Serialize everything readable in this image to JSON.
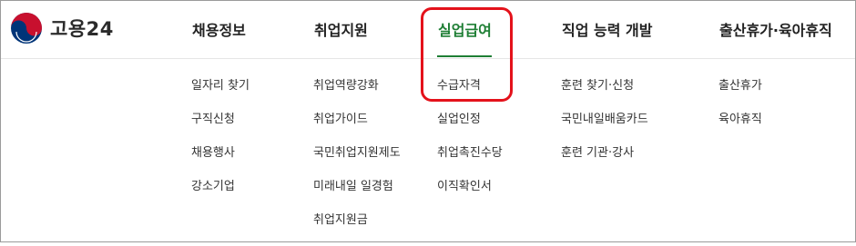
{
  "logo": {
    "text": "고용24",
    "icon": "government-taeguk-emblem-icon"
  },
  "nav": [
    {
      "label": "채용정보"
    },
    {
      "label": "취업지원"
    },
    {
      "label": "실업급여",
      "active": true
    },
    {
      "label": "직업 능력 개발"
    },
    {
      "label": "출산휴가·육아휴직"
    }
  ],
  "submenus": [
    [
      "일자리 찾기",
      "구직신청",
      "채용행사",
      "강소기업"
    ],
    [
      "취업역량강화",
      "취업가이드",
      "국민취업지원제도",
      "미래내일 일경험",
      "취업지원금"
    ],
    [
      "수급자격",
      "실업인정",
      "취업촉진수당",
      "이직확인서"
    ],
    [
      "훈련 찾기·신청",
      "국민내일배움카드",
      "훈련 기관·강사"
    ],
    [
      "출산휴가",
      "육아휴직"
    ]
  ],
  "colors": {
    "accent": "#1e7e34",
    "highlight": "#e4121b",
    "emblem_red": "#c8102e",
    "emblem_blue": "#003478"
  }
}
